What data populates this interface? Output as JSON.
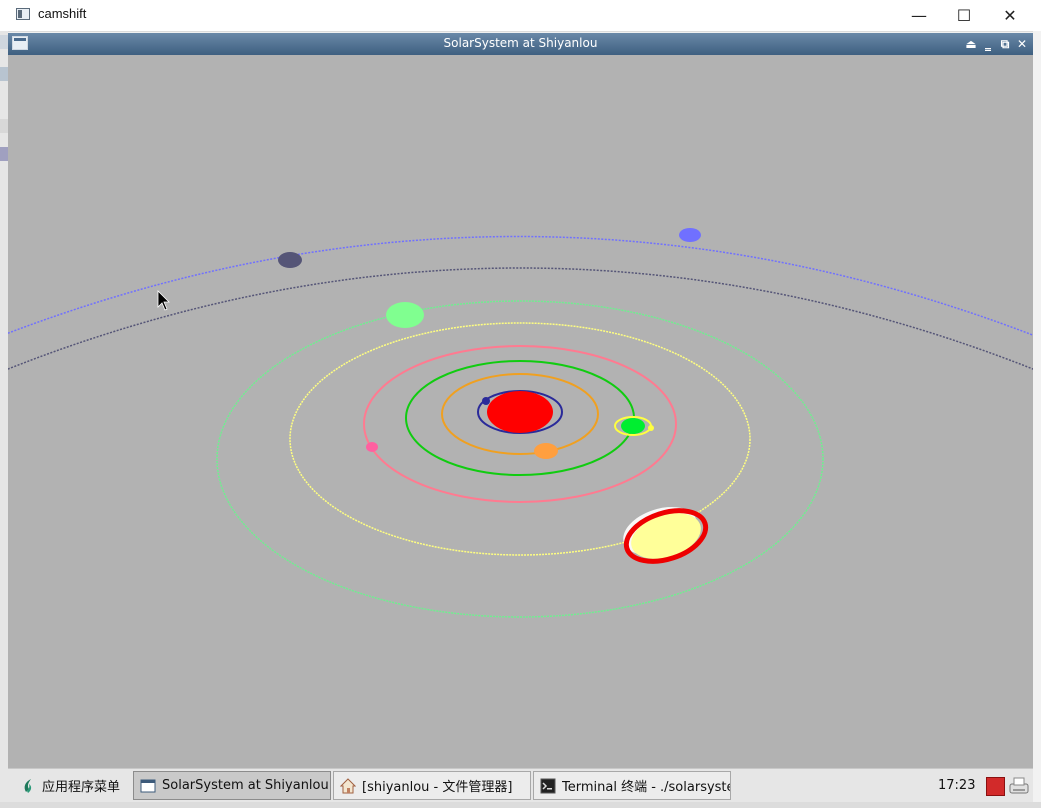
{
  "outer_window": {
    "title": "camshift",
    "controls": {
      "minimize": "—",
      "maximize": "☐",
      "close": "✕"
    }
  },
  "app_window": {
    "title": "SolarSystem at Shiyanlou",
    "buttons": {
      "shade": "⏏",
      "minimize": "‗",
      "maximize": "⧉",
      "close": "✕"
    }
  },
  "scene": {
    "background": "#b2b2b2",
    "sun_color": "#ff0000",
    "orbit_colors": [
      "#2a2a9a",
      "#f0a020",
      "#10cc10",
      "#ff7a90",
      "#ffff80",
      "#70ee90",
      "#555577",
      "#7070ff"
    ],
    "planet_colors": {
      "mercury": "#2a2a9a",
      "venus": "#ff9f3f",
      "earth": "#00ee30",
      "moon": "#ffff40",
      "mars": "#ff60a0",
      "jupiter": "#ffff99",
      "jupiter_ring": "#ee0000",
      "saturn": "#80ff90",
      "uranus": "#555577",
      "neptune": "#7070ff"
    }
  },
  "taskbar": {
    "start_label": "应用程序菜单",
    "tasks": [
      {
        "label": "SolarSystem at Shiyanlou",
        "icon": "window-icon",
        "active": true
      },
      {
        "label": "[shiyanlou - 文件管理器]",
        "icon": "home-folder-icon",
        "active": false
      },
      {
        "label": "Terminal 终端 - ./solarsystem",
        "icon": "terminal-icon",
        "active": false
      }
    ],
    "clock": "17:23"
  }
}
